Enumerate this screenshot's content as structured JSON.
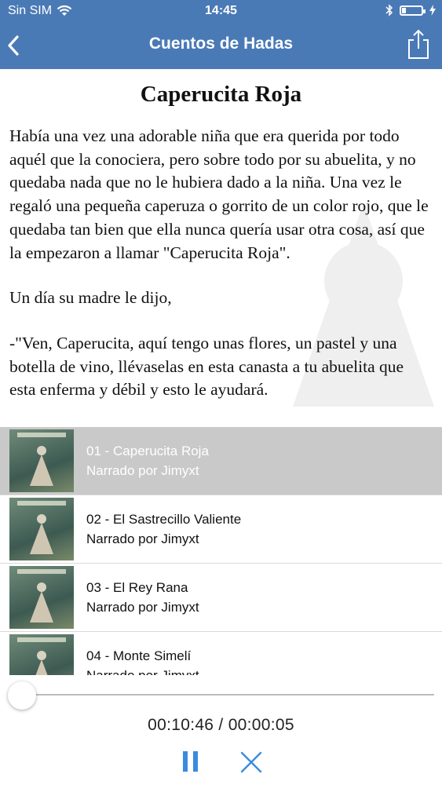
{
  "status_bar": {
    "carrier": "Sin SIM",
    "time": "14:45"
  },
  "nav": {
    "title": "Cuentos de Hadas"
  },
  "story": {
    "title": "Caperucita Roja",
    "paragraphs": [
      "Había una vez una adorable niña que era querida por todo aquél que la conociera, pero sobre todo por su abuelita, y no quedaba nada que no le hubiera dado a la niña. Una vez le regaló una pequeña caperuza o gorrito de un color rojo, que le quedaba tan bien que ella nunca quería usar otra cosa, así que la empezaron a llamar \"Caperucita Roja\".",
      "Un día su madre le dijo,",
      "-\"Ven, Caperucita, aquí tengo unas flores, un pastel y una botella de vino, llévaselas en esta canasta a tu abuelita que esta enferma y débil y esto le ayudará."
    ]
  },
  "playlist": [
    {
      "title": "01 - Caperucita Roja",
      "narrator": "Narrado por Jimyxt",
      "active": true
    },
    {
      "title": "02 - El Sastrecillo Valiente",
      "narrator": "Narrado por Jimyxt",
      "active": false
    },
    {
      "title": "03 - El Rey Rana",
      "narrator": "Narrado por Jimyxt",
      "active": false
    },
    {
      "title": "04 - Monte Simelí",
      "narrator": "Narrado por Jimyxt",
      "active": false
    }
  ],
  "player": {
    "time": "00:10:46 / 00:00:05",
    "progress": 0.0
  },
  "colors": {
    "header_bg": "#4a7ab6",
    "active_row_bg": "#c9c9c9",
    "control_blue": "#3a8be0"
  }
}
